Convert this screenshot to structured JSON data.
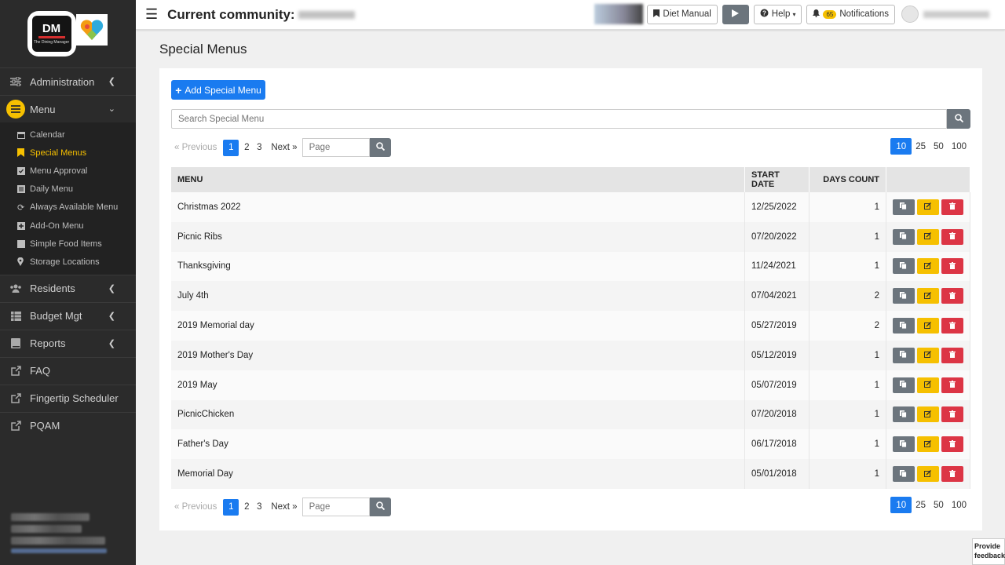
{
  "sidebar": {
    "logo_text": "DM",
    "logo_subtext": "The Dining Manager",
    "nav": [
      {
        "label": "Administration",
        "icon": "sliders-icon"
      },
      {
        "label": "Menu",
        "icon": "menu-icon"
      }
    ],
    "submenu": [
      {
        "label": "Calendar",
        "icon": "calendar-icon"
      },
      {
        "label": "Special Menus",
        "icon": "bookmark-icon"
      },
      {
        "label": "Menu Approval",
        "icon": "clipboard-check-icon"
      },
      {
        "label": "Daily Menu",
        "icon": "list-icon"
      },
      {
        "label": "Always Available Menu",
        "icon": "refresh-icon"
      },
      {
        "label": "Add-On Menu",
        "icon": "plus-square-icon"
      },
      {
        "label": "Simple Food Items",
        "icon": "square-icon"
      },
      {
        "label": "Storage Locations",
        "icon": "map-pin-icon"
      }
    ],
    "nav2": [
      {
        "label": "Residents",
        "icon": "users-icon"
      },
      {
        "label": "Budget Mgt",
        "icon": "table-icon"
      },
      {
        "label": "Reports",
        "icon": "book-icon"
      },
      {
        "label": "FAQ",
        "icon": "external-link-icon"
      },
      {
        "label": "Fingertip Scheduler",
        "icon": "external-link-icon"
      },
      {
        "label": "PQAM",
        "icon": "external-link-icon"
      }
    ]
  },
  "topbar": {
    "community_label": "Current community:",
    "diet_manual": "Diet Manual",
    "help": "Help",
    "notifications": "Notifications",
    "notif_count": "65"
  },
  "page": {
    "title": "Special Menus",
    "add_button": "Add Special Menu",
    "search_placeholder": "Search Special Menu",
    "page_placeholder": "Page",
    "prev": "« Previous",
    "next": "Next »",
    "pages": [
      "1",
      "2",
      "3"
    ],
    "active_page": "1",
    "sizes": [
      "10",
      "25",
      "50",
      "100"
    ],
    "active_size": "10"
  },
  "table": {
    "headers": [
      "MENU",
      "START DATE",
      "DAYS COUNT",
      ""
    ],
    "rows": [
      {
        "menu": "Christmas 2022",
        "start": "12/25/2022",
        "days": "1"
      },
      {
        "menu": "Picnic Ribs",
        "start": "07/20/2022",
        "days": "1"
      },
      {
        "menu": "Thanksgiving",
        "start": "11/24/2021",
        "days": "1"
      },
      {
        "menu": "July 4th",
        "start": "07/04/2021",
        "days": "2"
      },
      {
        "menu": "2019 Memorial day",
        "start": "05/27/2019",
        "days": "2"
      },
      {
        "menu": "2019 Mother's Day",
        "start": "05/12/2019",
        "days": "1"
      },
      {
        "menu": "2019 May",
        "start": "05/07/2019",
        "days": "1"
      },
      {
        "menu": "PicnicChicken",
        "start": "07/20/2018",
        "days": "1"
      },
      {
        "menu": "Father's Day",
        "start": "06/17/2018",
        "days": "1"
      },
      {
        "menu": "Memorial Day",
        "start": "05/01/2018",
        "days": "1"
      }
    ]
  },
  "feedback": "Provide feedback",
  "colors": {
    "accent": "#1a7bf0",
    "yellow": "#f6c000",
    "danger": "#dc3545",
    "secondary": "#6c757d",
    "sidebar": "#2b2b2b"
  }
}
